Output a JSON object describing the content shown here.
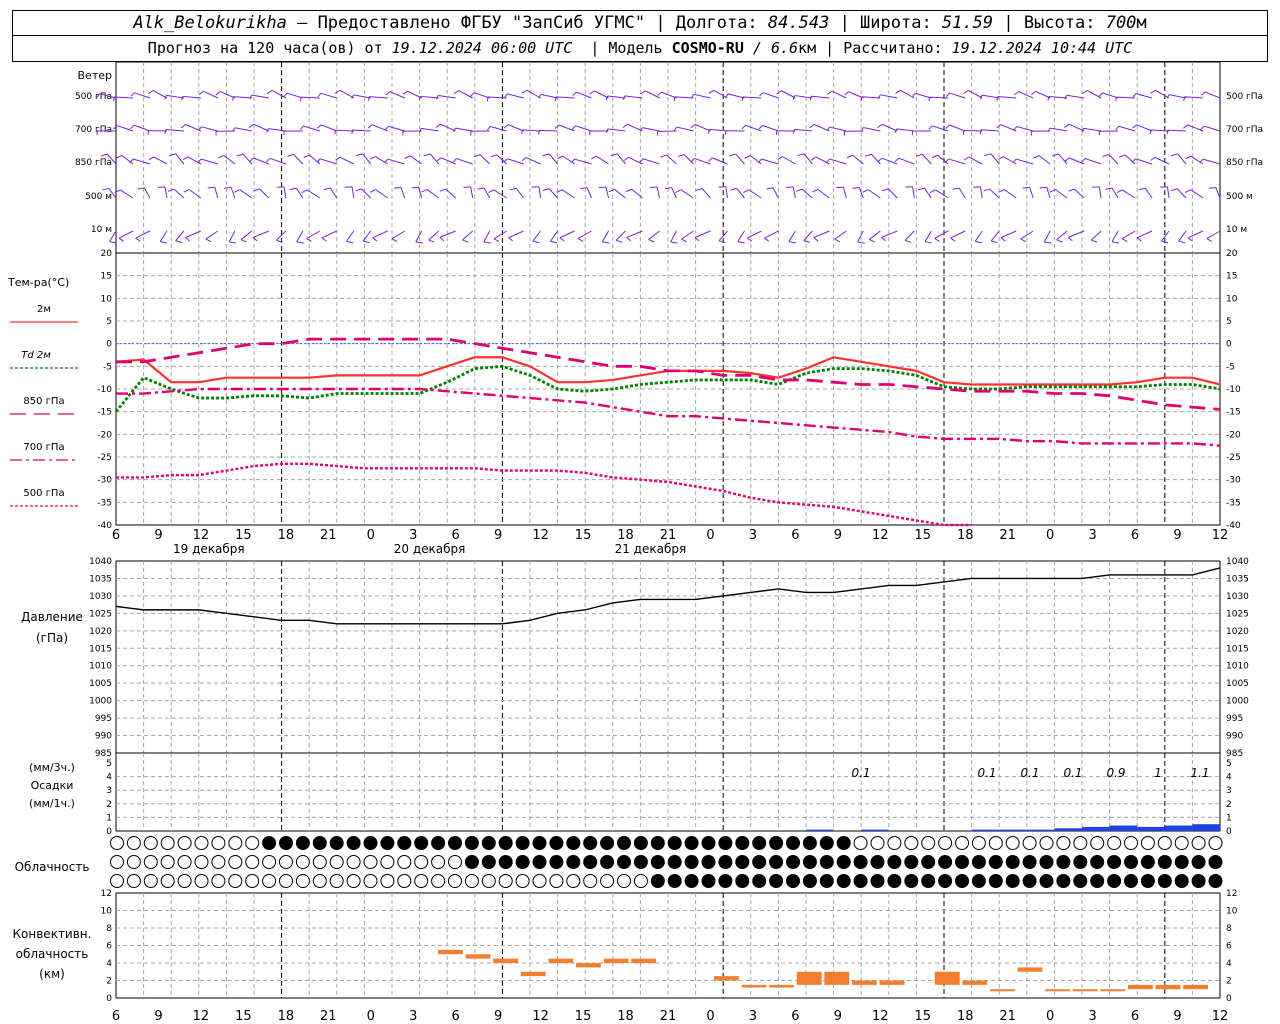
{
  "header": {
    "station": "Alk_Belokurikha",
    "provider": " – Предоставлено ФГБУ \"ЗапСиб УГМС\" | Долгота: ",
    "lon": "84.543",
    "lat_label": " | Широта: ",
    "lat": "51.59",
    "alt_label": " | Высота: ",
    "alt": "700",
    "alt_unit": "м",
    "forecast_prefix": "Прогноз на 120 часа(ов) от ",
    "forecast_from": "19.12.2024 06:00 UTC",
    "model_label": "  | Модель ",
    "model": "COSMO-RU",
    "resolution": " / 6.6",
    "res_unit": "км",
    "computed_label": " | Рассчитано: ",
    "computed": "19.12.2024 10:44 UTC"
  },
  "wind": {
    "title": "Ветер",
    "levels": [
      "500 гПа",
      "700 гПа",
      "850 гПа",
      "500 м",
      "10  м"
    ]
  },
  "temperature": {
    "title": "Тем-ра(°C)",
    "legend": [
      {
        "label": "2м",
        "color": "#ff3030",
        "dash": ""
      },
      {
        "label": "Td  2м",
        "color": "#008000",
        "dash": "3,2"
      },
      {
        "label": "850 гПа",
        "color": "#e0006e",
        "dash": "16,8"
      },
      {
        "label": "700 гПа",
        "color": "#e0006e",
        "dash": "12,4,3,4"
      },
      {
        "label": "500 гПа",
        "color": "#e0006e",
        "dash": "3,2"
      }
    ],
    "ticks": [
      20,
      15,
      10,
      5,
      0,
      -5,
      -10,
      -15,
      -20,
      -25,
      -30,
      -35,
      -40
    ]
  },
  "time_axis": {
    "hour_labels": [
      "6",
      "9",
      "12",
      "15",
      "18",
      "21",
      "0",
      "3",
      "6",
      "9",
      "12",
      "15",
      "18",
      "21",
      "0",
      "3",
      "6",
      "9",
      "12",
      "15",
      "18",
      "21",
      "0",
      "3",
      "6",
      "9",
      "12"
    ],
    "dates": [
      "19 декабря",
      "20 декабря",
      "21 декабря"
    ]
  },
  "pressure": {
    "title": "Давление",
    "unit": "(гПа)",
    "ticks": [
      1040,
      1035,
      1030,
      1025,
      1020,
      1015,
      1010,
      1005,
      1000,
      995,
      990,
      985
    ]
  },
  "precip": {
    "unit3": "(мм/3ч.)",
    "title": "Осадки",
    "unit1": "(мм/1ч.)",
    "ticks": [
      5,
      4,
      3,
      2,
      1,
      0
    ],
    "labels": [
      "0.1",
      "0.1",
      "0.1",
      "0.1",
      "0.9",
      "1",
      "1.1"
    ],
    "bar_color": "#2040e0"
  },
  "clouds": {
    "title": "Облачность"
  },
  "convective": {
    "title1": "Конвективн.",
    "title2": "облачность",
    "unit": "(км)",
    "ticks": [
      12,
      10,
      8,
      6,
      4,
      2,
      0
    ],
    "color": "#f08030"
  },
  "chart_data": {
    "type": "line",
    "x_hours": [
      0,
      3,
      6,
      9,
      12,
      15,
      18,
      21,
      24,
      27,
      30,
      33,
      36,
      39,
      42,
      45,
      48,
      51,
      54,
      57,
      60,
      63,
      66,
      69,
      72,
      75,
      78,
      81,
      84,
      87,
      90,
      93,
      96,
      99,
      102,
      105,
      108,
      111,
      114,
      117,
      120
    ],
    "series": [
      {
        "name": "2м",
        "values": [
          -4,
          -3.5,
          -8.5,
          -8.5,
          -7.5,
          -7.5,
          -7.5,
          -7.5,
          -7,
          -7,
          -7,
          -7,
          -5,
          -3,
          -3,
          -5,
          -8.5,
          -8.5,
          -8,
          -7,
          -6,
          -6,
          -6,
          -6.5,
          -7.5,
          -5.5,
          -3,
          -4,
          -5,
          -6,
          -8.5,
          -9,
          -9,
          -9,
          -9,
          -9,
          -9,
          -8.5,
          -7.5,
          -7.5,
          -9
        ]
      },
      {
        "name": "Td  2м",
        "values": [
          -15,
          -7.5,
          -10,
          -12,
          -12,
          -11.5,
          -11.5,
          -12,
          -11,
          -11,
          -11,
          -11,
          -8.5,
          -5.5,
          -5,
          -7,
          -10,
          -10.5,
          -10,
          -9,
          -8.5,
          -8,
          -8,
          -8,
          -9,
          -6.5,
          -5.5,
          -5.5,
          -6,
          -7,
          -9.5,
          -10,
          -10,
          -9.5,
          -9.5,
          -9.5,
          -9.5,
          -9.5,
          -9,
          -9,
          -10
        ]
      },
      {
        "name": "850 гПа",
        "values": [
          -4,
          -4,
          -3,
          -2,
          -1,
          0,
          0,
          1,
          1,
          1,
          1,
          1,
          1,
          0,
          -1,
          -2,
          -3,
          -4,
          -5,
          -5,
          -6,
          -6,
          -7,
          -7,
          -8,
          -8,
          -8.5,
          -9,
          -9,
          -9.5,
          -10,
          -10.5,
          -10.5,
          -10.5,
          -11,
          -11,
          -11.5,
          -12.5,
          -13.5,
          -14,
          -14.5
        ]
      },
      {
        "name": "700 гПа",
        "values": [
          -11,
          -11,
          -10.5,
          -10,
          -10,
          -10,
          -10,
          -10,
          -10,
          -10,
          -10,
          -10,
          -10.5,
          -11,
          -11.5,
          -12,
          -12.5,
          -13,
          -14,
          -15,
          -16,
          -16,
          -16.5,
          -17,
          -17.5,
          -18,
          -18.5,
          -19,
          -19.5,
          -20.5,
          -21,
          -21,
          -21,
          -21.5,
          -21.5,
          -22,
          -22,
          -22,
          -22,
          -22,
          -22.5
        ]
      },
      {
        "name": "500 гПа",
        "values": [
          -29.5,
          -29.5,
          -29,
          -29,
          -28,
          -27,
          -26.5,
          -26.5,
          -27,
          -27.5,
          -27.5,
          -27.5,
          -27.5,
          -27.5,
          -28,
          -28,
          -28,
          -28.5,
          -29.5,
          -30,
          -30.5,
          -31.5,
          -32.5,
          -34,
          -35,
          -35.5,
          -36,
          -37,
          -38,
          -39,
          -40,
          -41
        ]
      },
      {
        "name": "Давление",
        "values": [
          1027,
          1026,
          1026,
          1026,
          1025,
          1024,
          1023,
          1023,
          1022,
          1022,
          1022,
          1022,
          1022,
          1022,
          1022,
          1023,
          1025,
          1026,
          1028,
          1029,
          1029,
          1029,
          1030,
          1031,
          1032,
          1031,
          1031,
          1032,
          1033,
          1033,
          1034,
          1035,
          1035,
          1035,
          1035,
          1035,
          1036,
          1036,
          1036,
          1036,
          1038
        ]
      }
    ],
    "precip_mm": {
      "x_hours": [
        66,
        78,
        84,
        90,
        96,
        99,
        102,
        105,
        108,
        111,
        114,
        117,
        120
      ],
      "values": [
        0,
        0.1,
        0.1,
        0,
        0.1,
        0.1,
        0.1,
        0.2,
        0.3,
        0.4,
        0.3,
        0.4,
        0.5
      ]
    },
    "ylim_temp": [
      -40,
      20
    ],
    "ylim_pressure": [
      985,
      1040
    ],
    "ylim_precip": [
      0,
      5
    ],
    "ylim_convective": [
      0,
      12
    ],
    "grid": true
  }
}
